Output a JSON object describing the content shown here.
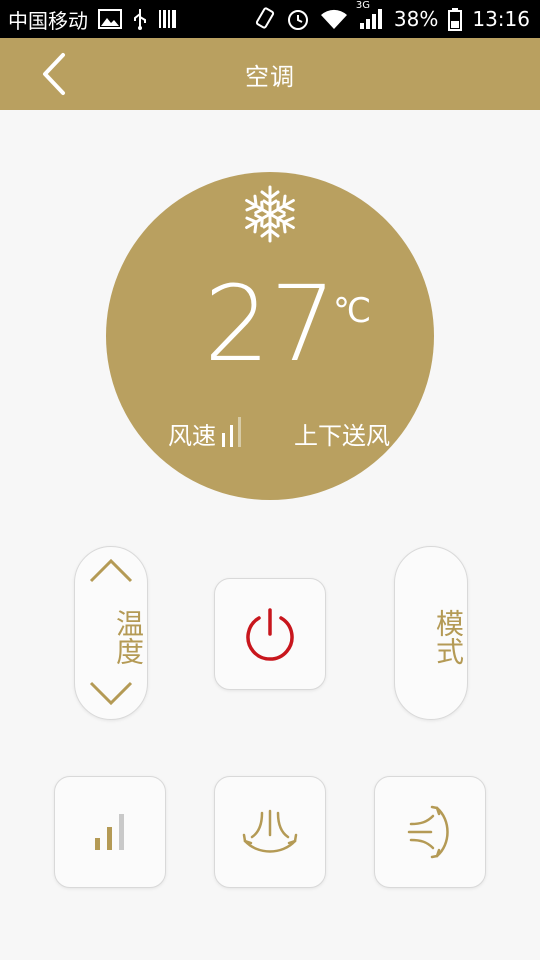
{
  "status_bar": {
    "carrier": "中国移动",
    "network": "3G",
    "battery": "38%",
    "time": "13:16"
  },
  "header": {
    "title": "空调",
    "back_icon": "chevron-left-icon"
  },
  "display": {
    "mode_icon": "snowflake-icon",
    "temperature": "27",
    "unit": "℃",
    "fan_label": "风速",
    "fan_level": 2,
    "fan_max_level": 3,
    "swing_label": "上下送风"
  },
  "controls": {
    "temperature_label": "温度",
    "mode_label": "模式"
  },
  "colors": {
    "accent": "#b9a060",
    "text_accent": "#b49a55",
    "power_red": "#c8161d",
    "background": "#f7f7f7"
  }
}
